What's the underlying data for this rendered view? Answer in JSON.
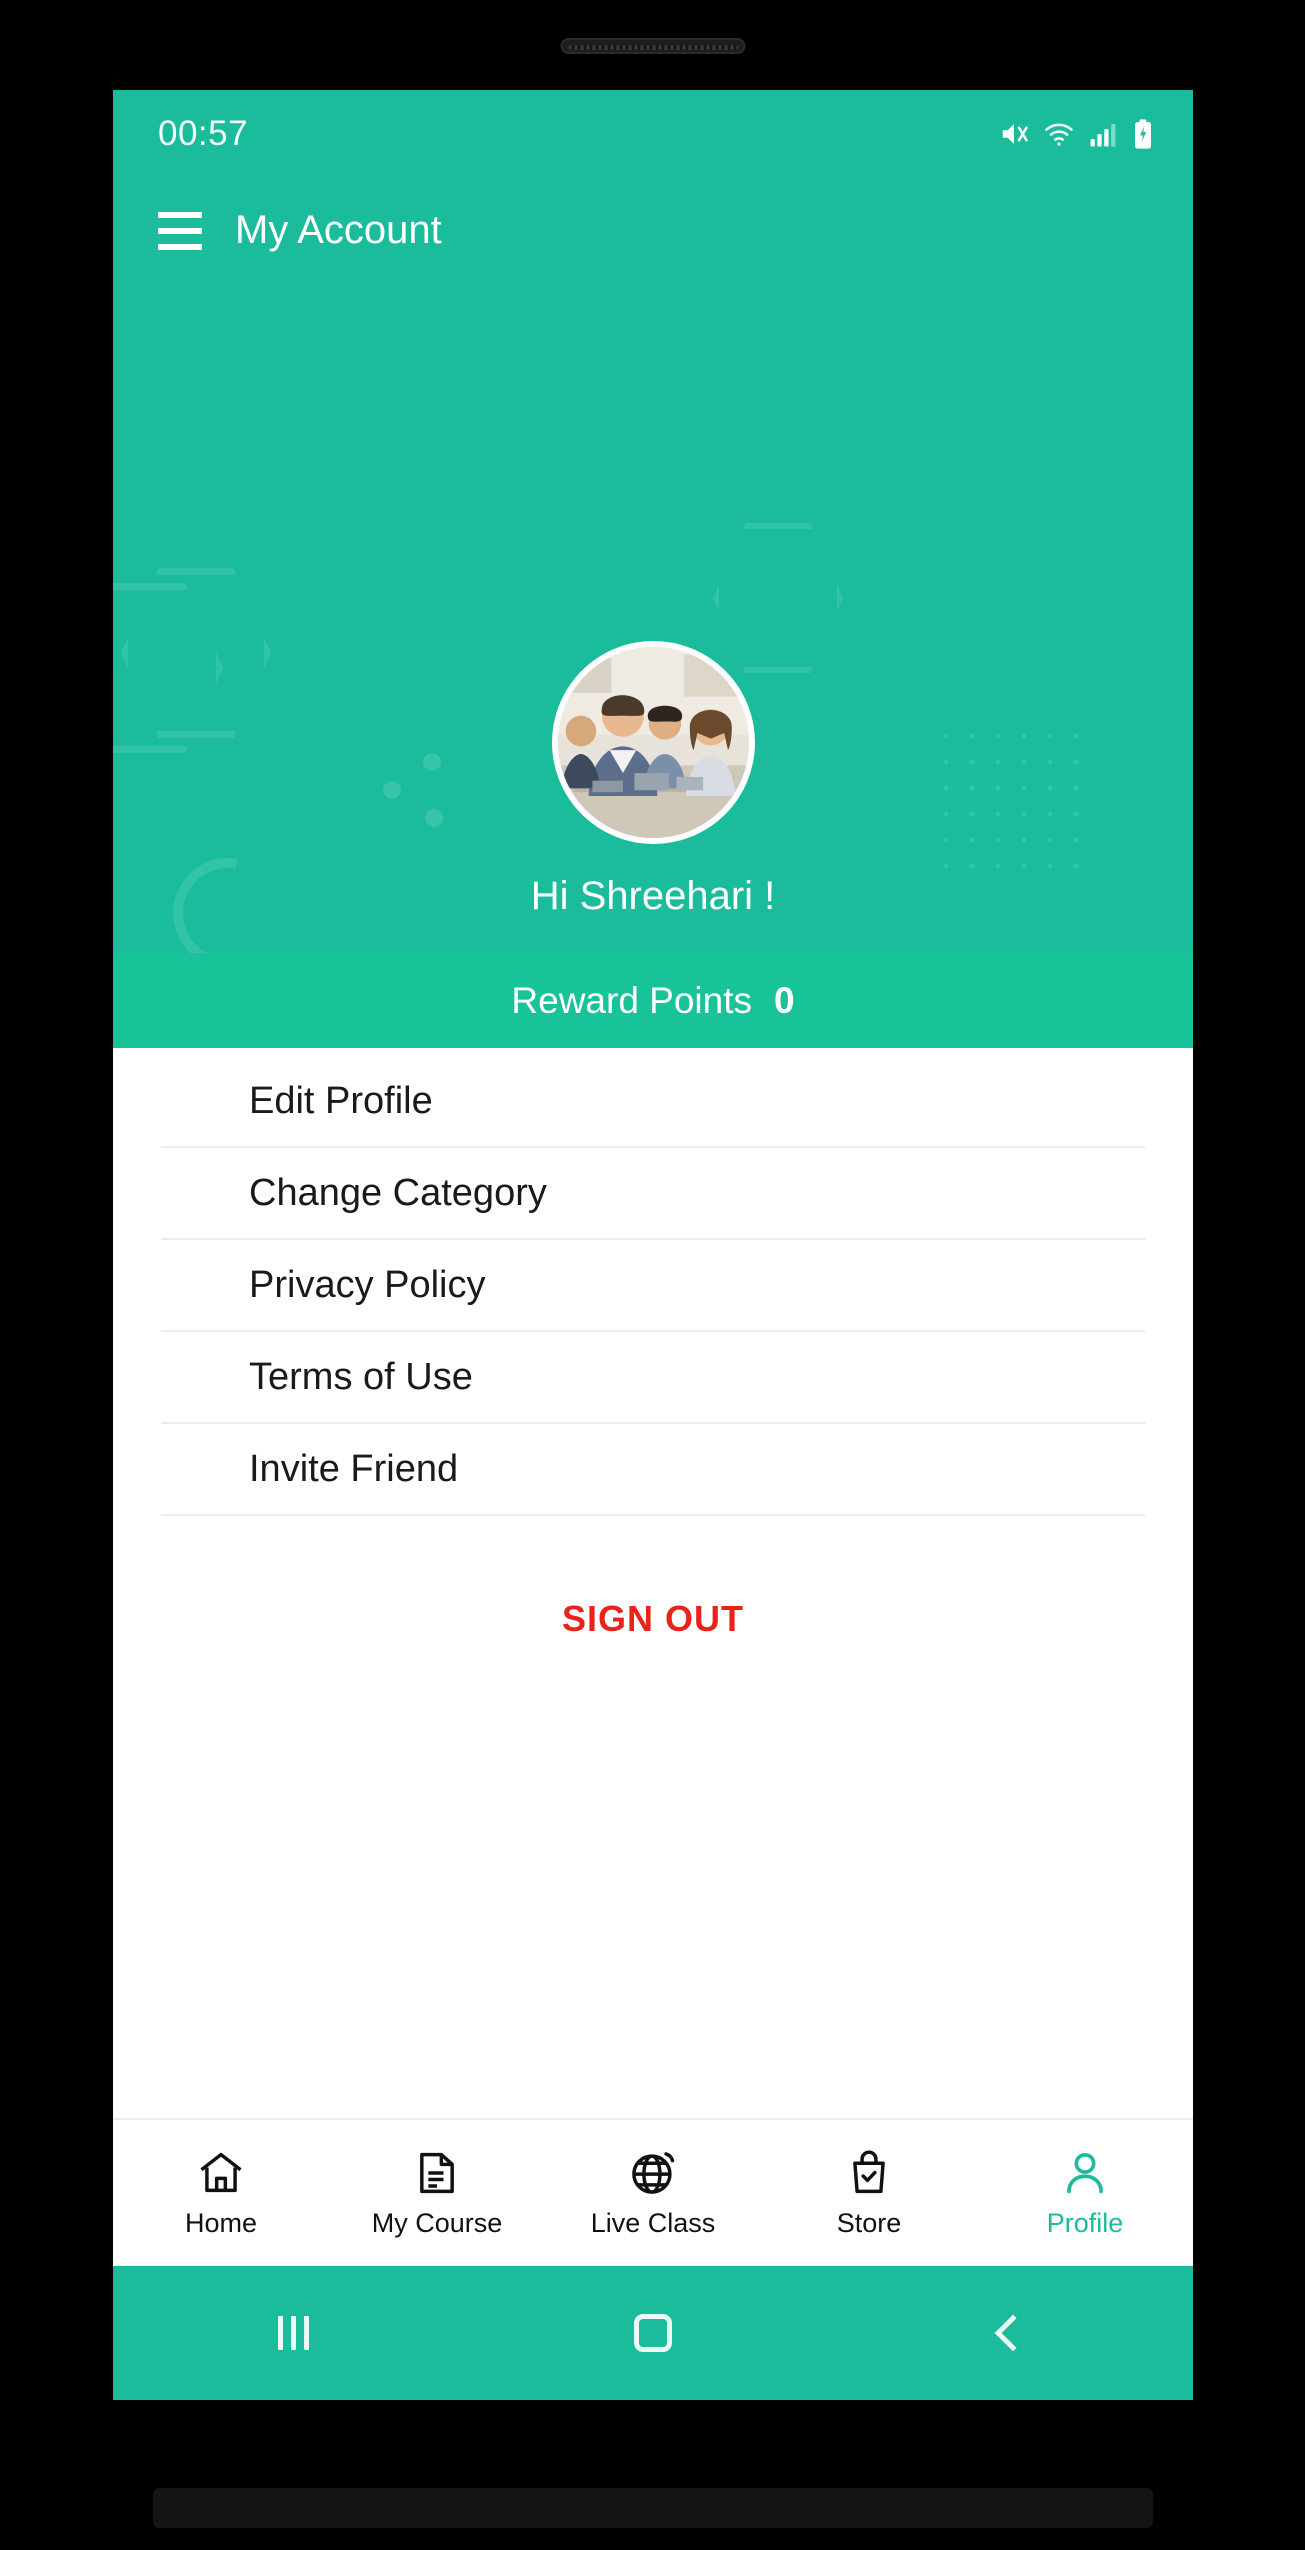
{
  "theme": {
    "primary": "#1BBC9B",
    "reward_band": "#18C39A",
    "signout_red": "#e8231c",
    "active_nav": "#1BBC9B",
    "screen_bg": "#ffffff"
  },
  "status_bar": {
    "time": "00:57",
    "icons": [
      "mute-icon",
      "wifi-icon",
      "signal-icon",
      "battery-charging-icon"
    ]
  },
  "app_bar": {
    "menu_icon": "hamburger-menu-icon",
    "title": "My Account"
  },
  "profile": {
    "avatar_alt": "student-group-photo",
    "greeting": "Hi Shreehari !"
  },
  "reward": {
    "label": "Reward Points",
    "value": "0"
  },
  "menu": {
    "items": [
      {
        "label": "Edit Profile"
      },
      {
        "label": "Change Category"
      },
      {
        "label": "Privacy Policy"
      },
      {
        "label": "Terms of Use"
      },
      {
        "label": "Invite Friend"
      }
    ],
    "sign_out": "SIGN OUT"
  },
  "bottom_nav": {
    "items": [
      {
        "label": "Home",
        "icon": "home-icon",
        "active": false
      },
      {
        "label": "My Course",
        "icon": "book-icon",
        "active": false
      },
      {
        "label": "Live Class",
        "icon": "globe-icon",
        "active": false
      },
      {
        "label": "Store",
        "icon": "shopping-bag-icon",
        "active": false
      },
      {
        "label": "Profile",
        "icon": "person-icon",
        "active": true
      }
    ]
  },
  "system_nav": {
    "recents": "recents-button",
    "home": "home-button",
    "back": "back-button"
  }
}
